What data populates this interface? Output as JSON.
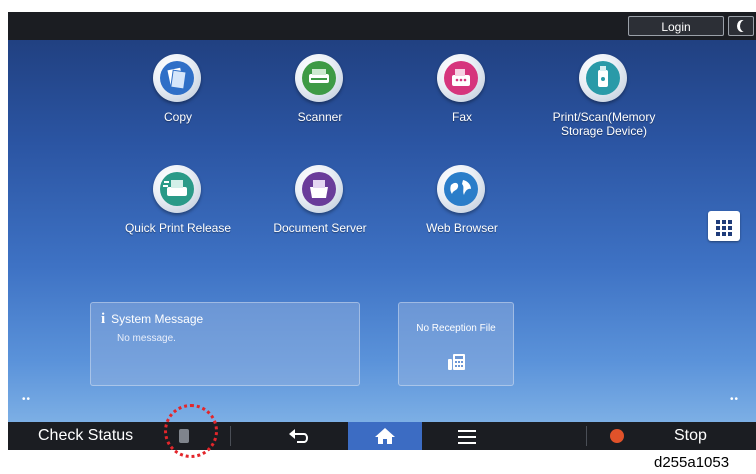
{
  "topbar": {
    "login_label": "Login"
  },
  "apps": [
    {
      "label": "Copy",
      "icon": "copy-icon"
    },
    {
      "label": "Scanner",
      "icon": "scanner-icon"
    },
    {
      "label": "Fax",
      "icon": "fax-icon"
    },
    {
      "label": "Print/Scan(Memory\nStorage Device)",
      "icon": "usb-memory-icon"
    },
    {
      "label": "Quick Print Release",
      "icon": "quick-print-icon"
    },
    {
      "label": "Document Server",
      "icon": "document-server-icon"
    },
    {
      "label": "Web Browser",
      "icon": "globe-icon"
    }
  ],
  "system_message": {
    "title": "System Message",
    "message": "No message."
  },
  "reception": {
    "label": "No Reception File"
  },
  "bottombar": {
    "check_status_label": "Check Status",
    "stop_label": "Stop"
  },
  "caption": "d255a1053",
  "colors": {
    "highlight": "#e3262b",
    "accent": "#3c6cc3",
    "stop": "#e0522a"
  }
}
